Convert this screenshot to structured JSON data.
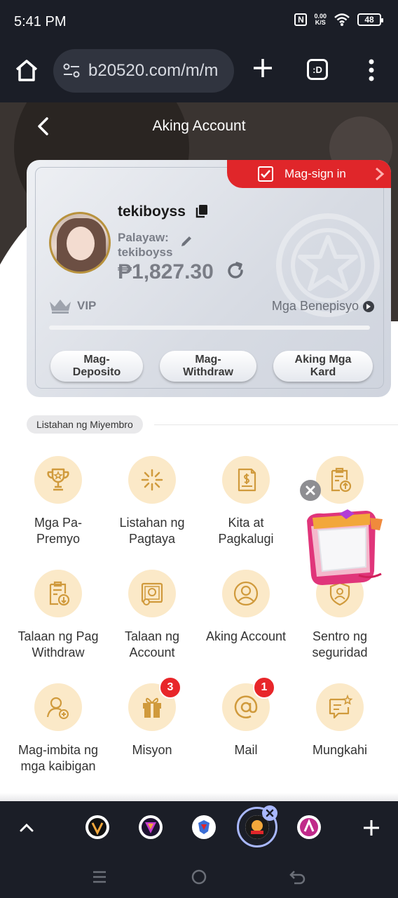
{
  "status_bar": {
    "time": "5:41 PM",
    "speed_value": "0.00",
    "speed_unit": "K/S",
    "battery": "48"
  },
  "browser": {
    "url": "b20520.com/m/m",
    "tabs_label": ":D"
  },
  "header": {
    "title": "Aking Account"
  },
  "card": {
    "signin_label": "Mag-sign in",
    "username": "tekiboyss",
    "nickname_label": "Palayaw:",
    "nickname_value": "tekiboyss",
    "balance": "₱1,827.30",
    "vip_label": "VIP",
    "benefits_label": "Mga Benepisyo",
    "vip_progress": 0,
    "buttons": {
      "deposit": "Mag-\nDeposito",
      "withdraw": "Mag-\nWithdraw",
      "cards": "Aking Mga\nKard"
    }
  },
  "section": {
    "title": "Listahan ng Miyembro"
  },
  "menu": [
    {
      "label": "Mga Pa-\nPremyo",
      "icon": "trophy-icon"
    },
    {
      "label": "Listahan ng\nPagtaya",
      "icon": "betting-list-icon"
    },
    {
      "label": "Kita at\nPagkalugi",
      "icon": "profit-loss-icon"
    },
    {
      "label": "",
      "icon": "deposit-record-icon"
    },
    {
      "label": "Talaan ng Pag\nWithdraw",
      "icon": "withdraw-record-icon"
    },
    {
      "label": "Talaan ng\nAccount",
      "icon": "account-record-icon"
    },
    {
      "label": "Aking Account",
      "icon": "user-icon"
    },
    {
      "label": "Sentro ng\nseguridad",
      "icon": "security-icon"
    },
    {
      "label": "Mag-imbita ng\nmga kaibigan",
      "icon": "invite-friend-icon"
    },
    {
      "label": "Misyon",
      "icon": "gift-icon",
      "badge": "3"
    },
    {
      "label": "Mail",
      "icon": "at-mail-icon",
      "badge": "1"
    },
    {
      "label": "Mungkahi",
      "icon": "feedback-icon"
    }
  ],
  "colors": {
    "accent_red": "#e0262a",
    "icon_bg": "#fbe9c8",
    "icon_stroke": "#d09a3c",
    "dark_bar": "#1b1e27"
  }
}
